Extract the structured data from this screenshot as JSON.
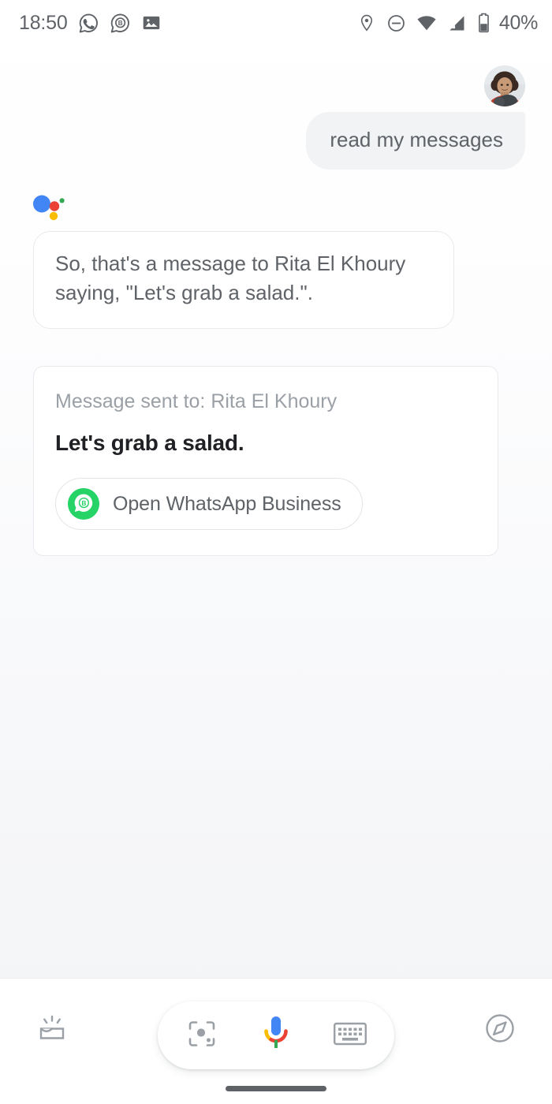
{
  "status_bar": {
    "time": "18:50",
    "battery_percent": "40%",
    "left_icons": [
      {
        "name": "whatsapp-icon",
        "label": "WhatsApp"
      },
      {
        "name": "whatsapp-business-icon",
        "label": "WhatsApp Business"
      },
      {
        "name": "screenshot-image-icon",
        "label": "Screenshot"
      }
    ],
    "right_icons": [
      {
        "name": "location-pin-icon",
        "label": "Location"
      },
      {
        "name": "do-not-disturb-icon",
        "label": "Do not disturb"
      },
      {
        "name": "wifi-icon",
        "label": "Wi-Fi"
      },
      {
        "name": "cell-signal-icon",
        "label": "Mobile signal"
      },
      {
        "name": "battery-icon",
        "label": "Battery"
      }
    ]
  },
  "conversation": {
    "avatar_alt": "User profile photo",
    "user_message": "read my messages",
    "assistant_logo_alt": "Google Assistant",
    "assistant_response": "So, that's a message to Rita El Khoury saying, \"Let's grab a salad.\".",
    "card": {
      "subtitle": "Message sent to: Rita El Khoury",
      "message": "Let's grab a salad.",
      "app_chip_label": "Open WhatsApp Business",
      "app_chip_icon": "whatsapp-business-icon"
    }
  },
  "bottom_bar": {
    "snapshot_icon": "snapshot-icon",
    "lens_icon": "google-lens-icon",
    "mic_icon": "google-microphone-icon",
    "keyboard_icon": "keyboard-icon",
    "explore_icon": "explore-compass-icon",
    "nav_handle": "gesture-navigation-handle"
  },
  "colors": {
    "google_blue": "#4285F4",
    "google_red": "#EA4335",
    "google_yellow": "#FBBC05",
    "google_green": "#34A853",
    "whatsapp_green": "#25D366",
    "text_primary": "#202124",
    "text_secondary": "#5f6368",
    "text_tertiary": "#9aa0a6",
    "bubble_gray": "#f1f3f4",
    "border": "#e8eaed"
  }
}
